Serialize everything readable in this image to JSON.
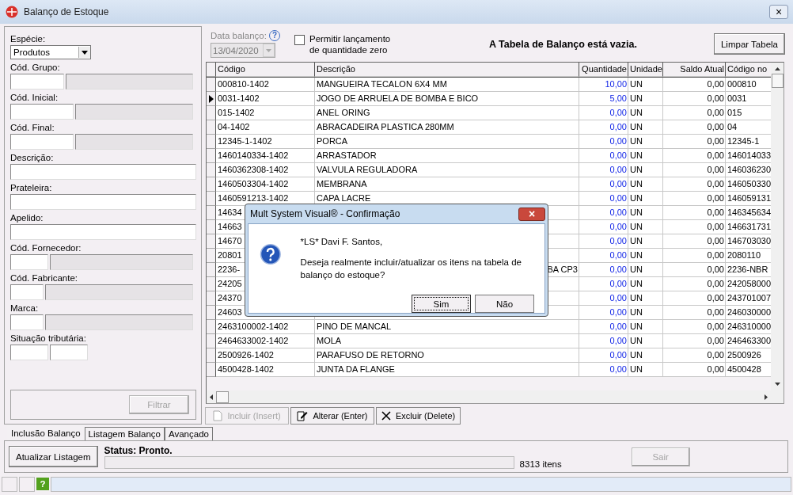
{
  "window": {
    "title": "Balanço de Estoque",
    "close": "×"
  },
  "filters": [
    {
      "kind": "combo",
      "label": "Espécie:",
      "value": "Produtos"
    },
    {
      "kind": "lookup",
      "label": "Cód. Grupo:"
    },
    {
      "kind": "lookup",
      "label": "Cód. Inicial:"
    },
    {
      "kind": "lookup",
      "label": "Cód. Final:"
    },
    {
      "kind": "text",
      "label": "Descrição:"
    },
    {
      "kind": "text",
      "label": "Prateleira:"
    },
    {
      "kind": "text",
      "label": "Apelido:"
    },
    {
      "kind": "lookup",
      "label": "Cód. Fornecedor:"
    },
    {
      "kind": "lookup",
      "label": "Cód. Fabricante:"
    },
    {
      "kind": "lookup",
      "label": "Marca:"
    },
    {
      "kind": "split",
      "label": "Situação tributária:"
    }
  ],
  "filter_button": {
    "label": "Filtrar",
    "disabled": true
  },
  "date": {
    "label": "Data balanço:",
    "help": "?",
    "value": "13/04/2020",
    "disabled": true
  },
  "zero_option": {
    "label": "Permitir lançamento de quantidade zero",
    "checked": false
  },
  "message": "A Tabela de Balanço está vazia.",
  "clear_button": {
    "label": "Limpar Tabela",
    "disabled": false
  },
  "table": {
    "columns": [
      "Código",
      "Descrição",
      "Quantidade",
      "Unidade",
      "Saldo Atual",
      "Código no"
    ],
    "rows": [
      {
        "current": false,
        "cells": [
          "000810-1402",
          "MANGUEIRA TECALON 6X4 MM",
          "10,00",
          "UN",
          "0,00",
          "000810"
        ]
      },
      {
        "current": true,
        "cells": [
          "0031-1402",
          "JOGO DE ARRUELA DE BOMBA E BICO",
          "5,00",
          "UN",
          "0,00",
          "0031"
        ]
      },
      {
        "current": false,
        "cells": [
          "015-1402",
          "ANEL ORING",
          "0,00",
          "UN",
          "0,00",
          "015"
        ]
      },
      {
        "current": false,
        "cells": [
          "04-1402",
          "ABRACADEIRA PLASTICA 280MM",
          "0,00",
          "UN",
          "0,00",
          "04"
        ]
      },
      {
        "current": false,
        "cells": [
          "12345-1-1402",
          "PORCA",
          "0,00",
          "UN",
          "0,00",
          "12345-1"
        ]
      },
      {
        "current": false,
        "cells": [
          "1460140334-1402",
          "ARRASTADOR",
          "0,00",
          "UN",
          "0,00",
          "146014033"
        ]
      },
      {
        "current": false,
        "cells": [
          "1460362308-1402",
          "VALVULA REGULADORA",
          "0,00",
          "UN",
          "0,00",
          "146036230"
        ]
      },
      {
        "current": false,
        "cells": [
          "1460503304-1402",
          "MEMBRANA",
          "0,00",
          "UN",
          "0,00",
          "146050330"
        ]
      },
      {
        "current": false,
        "cells": [
          "1460591213-1402",
          "CAPA LACRE",
          "0,00",
          "UN",
          "0,00",
          "146059131"
        ]
      },
      {
        "current": false,
        "cells": [
          "14634",
          "",
          "0,00",
          "UN",
          "0,00",
          "146345634"
        ]
      },
      {
        "current": false,
        "cells": [
          "14663",
          "",
          "0,00",
          "UN",
          "0,00",
          "146631731"
        ]
      },
      {
        "current": false,
        "cells": [
          "14670",
          "",
          "0,00",
          "UN",
          "0,00",
          "146703030"
        ]
      },
      {
        "current": false,
        "cells": [
          "20801",
          "",
          "0,00",
          "UN",
          "0,00",
          "2080110"
        ]
      },
      {
        "current": false,
        "cells": [
          "2236-",
          "BA CP3",
          "0,00",
          "UN",
          "0,00",
          "2236-NBR"
        ]
      },
      {
        "current": false,
        "cells": [
          "24205",
          "",
          "0,00",
          "UN",
          "0,00",
          "242058000"
        ]
      },
      {
        "current": false,
        "cells": [
          "24370",
          "",
          "0,00",
          "UN",
          "0,00",
          "243701007"
        ]
      },
      {
        "current": false,
        "cells": [
          "24603",
          "",
          "0,00",
          "UN",
          "0,00",
          "246030000"
        ]
      },
      {
        "current": false,
        "cells": [
          "2463100002-1402",
          "PINO DE MANCAL",
          "0,00",
          "UN",
          "0,00",
          "246310000"
        ]
      },
      {
        "current": false,
        "cells": [
          "2464633002-1402",
          "MOLA",
          "0,00",
          "UN",
          "0,00",
          "246463300"
        ]
      },
      {
        "current": false,
        "cells": [
          "2500926-1402",
          "PARAFUSO DE RETORNO",
          "0,00",
          "UN",
          "0,00",
          "2500926"
        ]
      },
      {
        "current": false,
        "cells": [
          "4500428-1402",
          "JUNTA DA FLANGE",
          "0,00",
          "UN",
          "0,00",
          "4500428"
        ]
      }
    ]
  },
  "actions": [
    {
      "kind": "new",
      "label": "Incluir (Insert)",
      "disabled": true
    },
    {
      "kind": "edit",
      "label": "Alterar (Enter)",
      "disabled": false
    },
    {
      "kind": "delete",
      "label": "Excluir (Delete)",
      "disabled": false
    }
  ],
  "tabs": [
    {
      "label": "Inclusão Balanço",
      "selected": true
    },
    {
      "label": "Listagem Balanço",
      "selected": false
    },
    {
      "label": "Avançado",
      "selected": false
    }
  ],
  "refresh_button": {
    "label": "Atualizar Listagem",
    "disabled": false
  },
  "status": "Status: Pronto.",
  "progress": {
    "level": 0
  },
  "count": "8313 itens",
  "exit_button": {
    "label": "Sair",
    "disabled": true
  },
  "status_bar": {
    "help": "?"
  },
  "dialog": {
    "title": "Mult System Visual® - Confirmação",
    "close": "×",
    "greeting": "*LS* Davi F. Santos,",
    "question": "Deseja realmente incluir/atualizar os itens na tabela de balanço do estoque?",
    "buttons": [
      {
        "label": "Sim",
        "focused": true
      },
      {
        "label": "Não",
        "focused": false
      }
    ]
  }
}
